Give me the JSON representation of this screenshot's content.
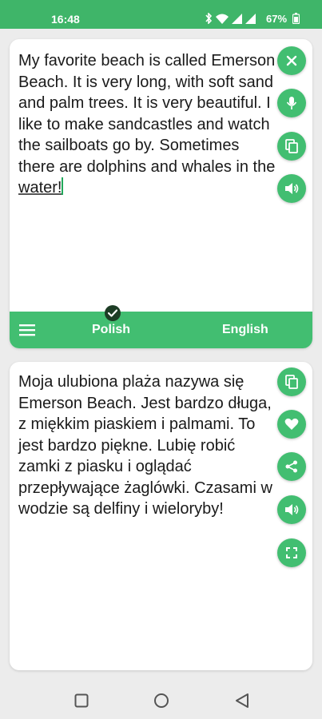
{
  "status_bar": {
    "time": "16:48",
    "battery_percent": "67%",
    "icons": [
      "bluetooth-icon",
      "wifi-icon",
      "signal-icon",
      "signal-icon",
      "battery-icon"
    ]
  },
  "source": {
    "text_main": "My favorite beach is called Emerson Beach. It is very long, with soft sand and palm trees. It is very beautiful. I like to make sandcastles and watch the sailboats go by. Sometimes there are dolphins and whales in the ",
    "text_underlined": "water!",
    "actions": [
      "clear-icon",
      "microphone-icon",
      "copy-icon",
      "speaker-icon"
    ]
  },
  "language_bar": {
    "source_language": "Polish",
    "target_language": "English"
  },
  "target": {
    "text": "Moja ulubiona plaża nazywa się Emerson Beach. Jest bardzo długa, z miękkim piaskiem i palmami. To jest bardzo piękne. Lubię robić zamki z piasku i oglądać przepływające żaglówki. Czasami w wodzie są delfiny i wieloryby!",
    "actions": [
      "copy-icon",
      "heart-icon",
      "share-icon",
      "speaker-icon",
      "fullscreen-icon"
    ]
  },
  "colors": {
    "accent": "#42be71",
    "status_bar": "#3fb569",
    "check_badge": "#1d3d25"
  }
}
